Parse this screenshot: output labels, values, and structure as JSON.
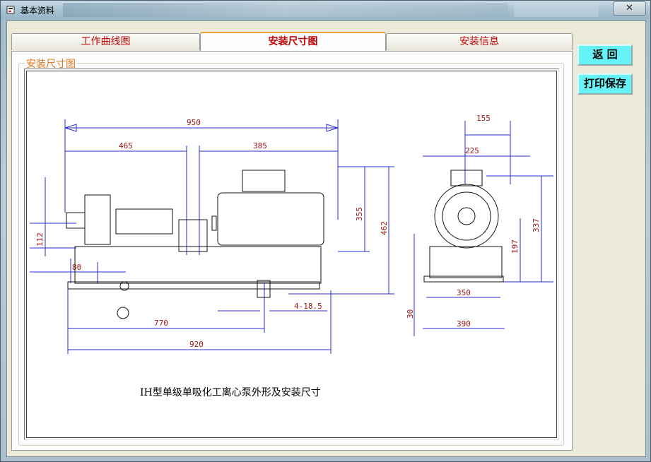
{
  "window": {
    "title": "基本资料",
    "close_glyph": "✕"
  },
  "tabs": [
    {
      "label": "工作曲线图",
      "active": false
    },
    {
      "label": "安装尺寸图",
      "active": true
    },
    {
      "label": "安装信息",
      "active": false
    }
  ],
  "group": {
    "label": "安装尺寸图"
  },
  "drawing": {
    "caption": "IH型单级单吸化工离心泵外形及安装尺寸",
    "dimensions": {
      "d950": "950",
      "d465": "465",
      "d385": "385",
      "d355": "355",
      "d462": "462",
      "d112": "112",
      "d80": "80",
      "d770": "770",
      "d920": "920",
      "d4_18_5": "4-18.5",
      "d155": "155",
      "d225": "225",
      "d337": "337",
      "d197": "197",
      "d350": "350",
      "d390": "390",
      "d30": "30"
    },
    "line_color": "#2a2ad0",
    "dim_text_color": "#a01818"
  },
  "buttons": {
    "back_label": "返 回",
    "print_save_label": "打印保存"
  }
}
